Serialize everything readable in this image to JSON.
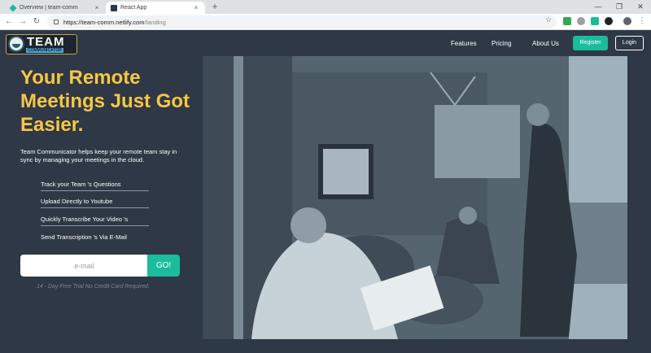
{
  "browser": {
    "tabs": [
      {
        "title": "Overview | team-comm",
        "close": "×"
      },
      {
        "title": "React App",
        "close": "×"
      }
    ],
    "new_tab": "+",
    "window_controls": {
      "minimize": "—",
      "maximize": "❐",
      "close": "✕"
    },
    "back": "←",
    "forward": "→",
    "reload": "↻",
    "url_host": "https://team-comm.netlify.com",
    "url_path": "/landing",
    "star": "☆",
    "menu": "⋮"
  },
  "nav": {
    "logo_title": "TEAM",
    "logo_sub": "COMMUNICATOR",
    "links": [
      "Features",
      "Pricing",
      "About Us"
    ],
    "register": "Register",
    "login": "Login"
  },
  "hero": {
    "headline": "Your Remote Meetings Just Got Easier.",
    "lead": "Team Communicator helps keep your remote team stay in sync by managing your meetings in the cloud.",
    "features": [
      "Track your Team 's Questions",
      "Upload Directly to Youtube",
      "Quickly Transcribe Your Video 's",
      "Send Transcription 's Via E-Mail"
    ],
    "email_placeholder": "e-mail",
    "go_label": "GO!",
    "trial_note": "14 - Day Free Trial No Credit Card Required."
  },
  "colors": {
    "accent": "#1abc9c",
    "headline": "#f7c744",
    "background": "#2f3846"
  }
}
